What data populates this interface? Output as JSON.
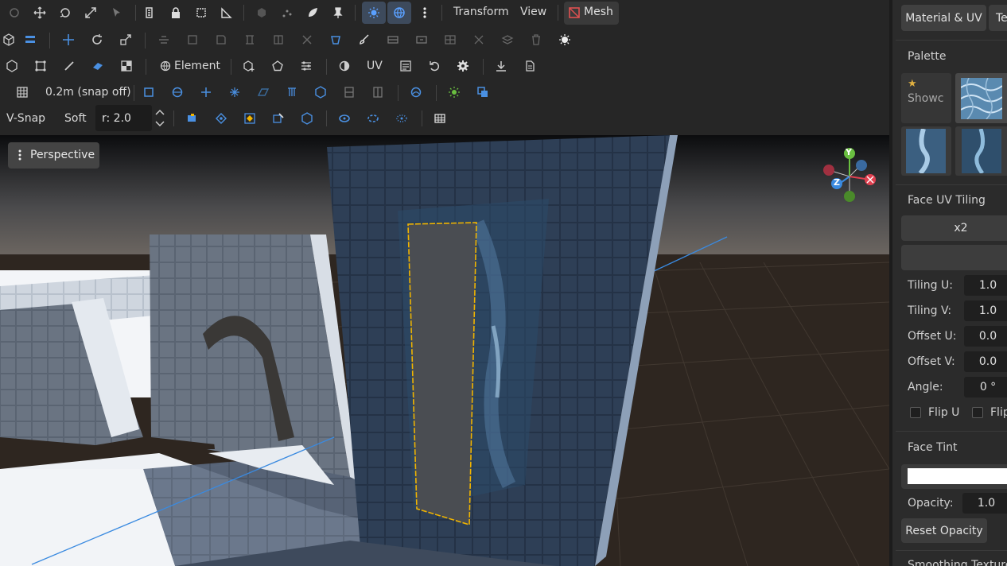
{
  "toolbar": {
    "menu_transform": "Transform",
    "menu_view": "View",
    "mesh_label": "Mesh",
    "element_label": "Element",
    "uv_label": "UV",
    "snap_label": "0.2m (snap off)",
    "vsnap_label": "V-Snap",
    "soft_label": "Soft",
    "radius_value": "r: 2.0"
  },
  "viewport": {
    "mode_label": "Perspective",
    "gizmo": {
      "y": "Y",
      "z": "Z"
    }
  },
  "panel": {
    "tab_material": "Material & UV",
    "tab_second": "Te",
    "palette_title": "Palette",
    "showcase_label": "Showc",
    "uv_tiling_title": "Face UV Tiling",
    "x2_label": "x2",
    "tiling_u_label": "Tiling U:",
    "tiling_u": "1.0",
    "tiling_v_label": "Tiling V:",
    "tiling_v": "1.0",
    "offset_u_label": "Offset U:",
    "offset_u": "0.0",
    "offset_v_label": "Offset V:",
    "offset_v": "0.0",
    "angle_label": "Angle:",
    "angle": "0 °",
    "flip_u_label": "Flip U",
    "flip_v_label": "Flip",
    "face_tint_title": "Face Tint",
    "opacity_label": "Opacity:",
    "opacity": "1.0",
    "reset_opacity_label": "Reset Opacity",
    "bottom_cut_label": "Smoothing Texture"
  },
  "colors": {
    "accent": "#4a90e2",
    "active_bg": "#3d4a5c",
    "mesh_red": "#e05050",
    "selection_yellow": "#f0b400"
  }
}
